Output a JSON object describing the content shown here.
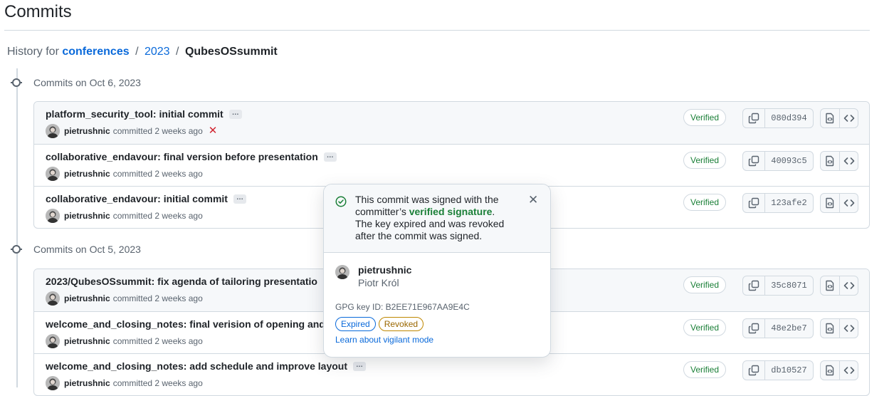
{
  "page": {
    "title": "Commits"
  },
  "breadcrumb": {
    "prefix": "History for",
    "parts": [
      "conferences",
      "2023"
    ],
    "separator": "/",
    "current": "QubesOSsummit"
  },
  "groups": [
    {
      "date_label": "Commits on Oct 6, 2023",
      "commits": [
        {
          "message": "platform_security_tool: initial commit",
          "author": "pietrushnic",
          "meta": "committed 2 weeks ago",
          "status": "failure",
          "badge": "Verified",
          "sha": "080d394"
        },
        {
          "message": "collaborative_endavour: final version before presentation",
          "author": "pietrushnic",
          "meta": "committed 2 weeks ago",
          "badge": "Verified",
          "sha": "40093c5"
        },
        {
          "message": "collaborative_endavour: initial commit",
          "author": "pietrushnic",
          "meta": "committed 2 weeks ago",
          "badge": "Verified",
          "sha": "123afe2"
        }
      ]
    },
    {
      "date_label": "Commits on Oct 5, 2023",
      "commits": [
        {
          "message": "2023/QubesOSsummit: fix agenda of tailoring presentatio",
          "author": "pietrushnic",
          "meta": "committed 2 weeks ago",
          "badge": "Verified",
          "sha": "35c8071"
        },
        {
          "message": "welcome_and_closing_notes: final verision of opening and",
          "author": "pietrushnic",
          "meta": "committed 2 weeks ago",
          "badge": "Verified",
          "sha": "48e2be7"
        },
        {
          "message": "welcome_and_closing_notes: add schedule and improve layout",
          "author": "pietrushnic",
          "meta": "committed 2 weeks ago",
          "badge": "Verified",
          "sha": "db10527"
        }
      ]
    }
  ],
  "popover": {
    "line1": "This commit was signed with the",
    "line2_prefix": "committer’s",
    "verified_signature": "verified signature",
    "line2_suffix": ".",
    "line3": "The key expired and was revoked",
    "line4": "after the commit was signed.",
    "login": "pietrushnic",
    "full_name": "Piotr Król",
    "gpg_key": "GPG key ID: B2EE71E967AA9E4C",
    "labels": {
      "expired": "Expired",
      "revoked": "Revoked"
    },
    "link": "Learn about vigilant mode",
    "close_glyph": "✕"
  },
  "glyphs": {
    "ellipsis": "…",
    "failure_x": "✕"
  },
  "colors": {
    "link": "#0969da",
    "verified": "#1a7f37",
    "danger": "#d1242f",
    "revoked": "#9a6700"
  },
  "icons": [
    "commit-dot-icon",
    "copy-icon",
    "browse-files-icon",
    "code-icon",
    "check-circle-icon",
    "close-icon",
    "x-icon"
  ]
}
